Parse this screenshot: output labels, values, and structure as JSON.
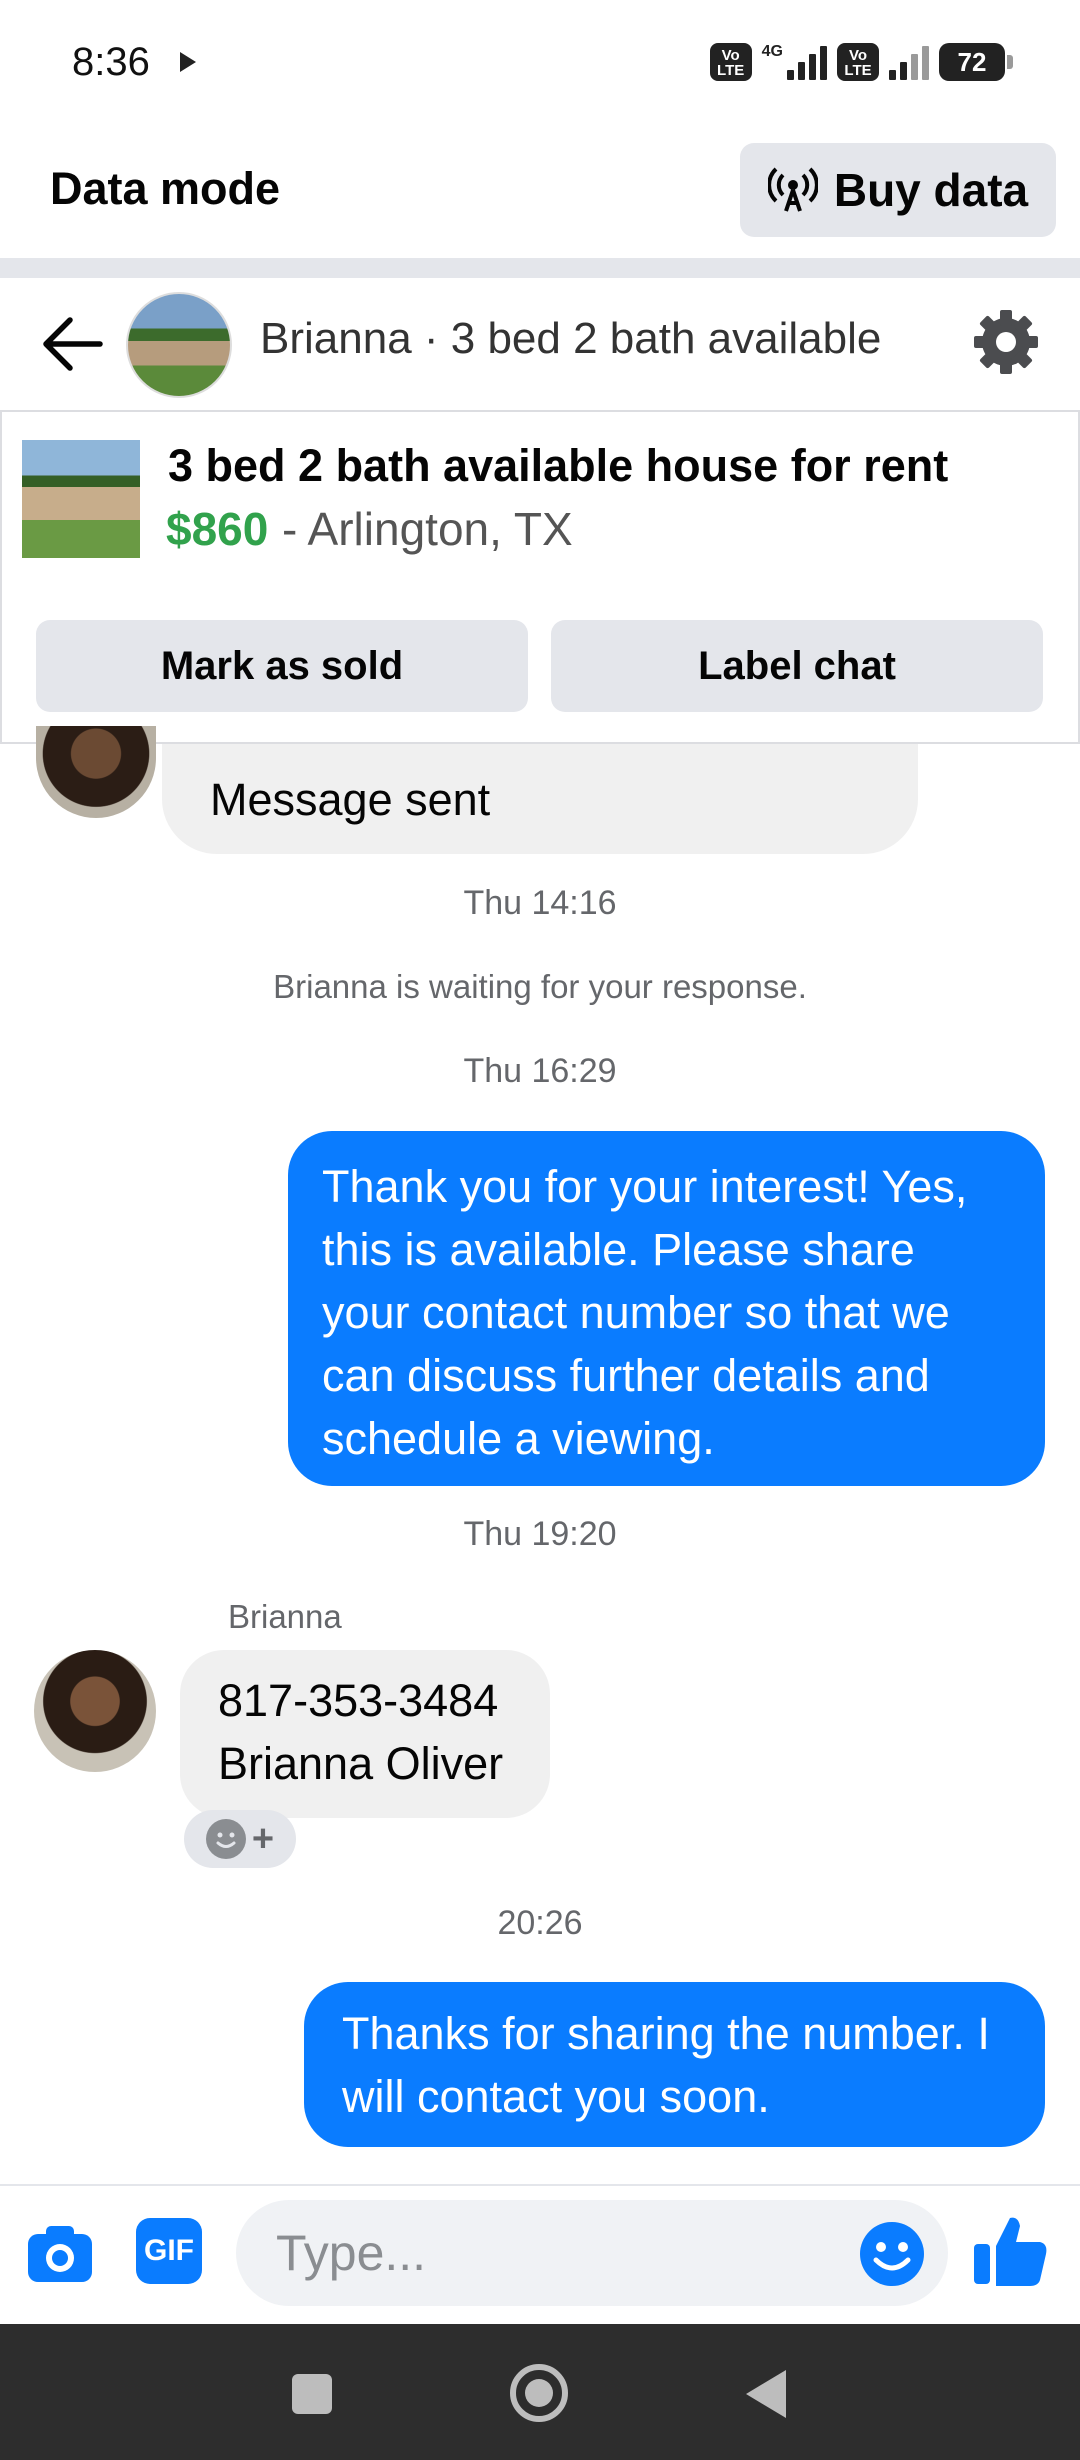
{
  "status_bar": {
    "time": "8:36",
    "volte_label": "Vo LTE",
    "network": "4G",
    "battery": "72"
  },
  "data_mode": {
    "title": "Data mode",
    "buy_data_label": "Buy data"
  },
  "chat_header": {
    "title": "Brianna · 3 bed 2 bath available"
  },
  "listing": {
    "title": "3 bed 2 bath available house for rent",
    "price": "$860",
    "location": "- Arlington, TX",
    "mark_as_sold_label": "Mark as sold",
    "label_chat_label": "Label chat"
  },
  "messages": {
    "partial_incoming": "Message sent",
    "time_1": "Thu 14:16",
    "waiting_notice": "Brianna is waiting for your response.",
    "time_2": "Thu 16:29",
    "outgoing_1": "Thank you for your interest! Yes, this is available. Please share your contact number so that we can discuss further details and schedule a viewing.",
    "time_3": "Thu 19:20",
    "sender_name": "Brianna",
    "incoming_line_1": "817-353-3484",
    "incoming_line_2": "Brianna Oliver",
    "time_4": "20:26",
    "outgoing_2": "Thanks for sharing the number. I will contact you soon."
  },
  "composer": {
    "gif_label": "GIF",
    "placeholder": "Type..."
  },
  "colors": {
    "messenger_blue": "#0a7cff",
    "price_green": "#31a24c",
    "button_gray": "#e4e6eb"
  },
  "icons": [
    "play-icon",
    "back-arrow-icon",
    "gear-icon",
    "broadcast-icon",
    "camera-icon",
    "gif-icon",
    "emoji-icon",
    "thumbs-up-icon",
    "add-reaction-icon"
  ]
}
